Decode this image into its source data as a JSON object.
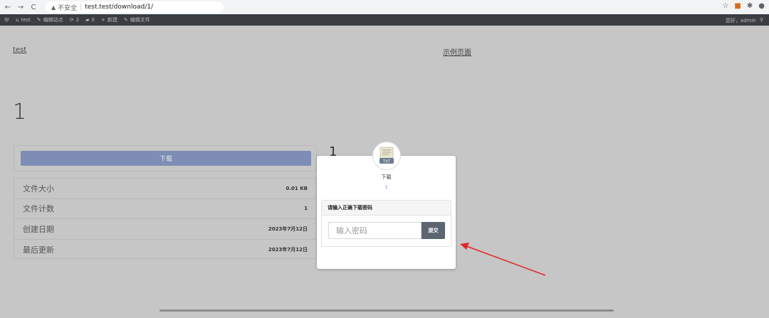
{
  "browser": {
    "back_icon": "arrow-left-icon",
    "forward_icon": "arrow-right-icon",
    "reload_icon": "reload-icon",
    "security_icon": "warning-triangle-icon",
    "security_label": "不安全",
    "url": "test.test/download/1/"
  },
  "admin_bar": {
    "site_name": "test",
    "customize_label": "编辑站点",
    "updates_count": "2",
    "comments_count": "0",
    "new_label": "新建",
    "edit_label": "编辑文件",
    "greeting": "您好，admin"
  },
  "page": {
    "site_link": "test",
    "sample_page_link": "示例页面",
    "title": "1",
    "download_button": "下载",
    "background_count": "1",
    "info": [
      {
        "label": "文件大小",
        "value": "0.01 KB"
      },
      {
        "label": "文件计数",
        "value": "1"
      },
      {
        "label": "创建日期",
        "value": "2023年7月12日"
      },
      {
        "label": "最后更新",
        "value": "2023年7月12日"
      }
    ]
  },
  "modal": {
    "file_icon": "txt-file-icon",
    "file_type_label": "TXT",
    "title": "下载",
    "subtitle": "1",
    "password_heading": "请输入正确下载密码",
    "password_placeholder": "输入密码",
    "submit_label": "提交"
  },
  "colors": {
    "overlay": "#c6c6c6",
    "download_button": "#7d8db5",
    "submit_button": "#5c6670",
    "annotation_arrow": "#e0282a"
  }
}
